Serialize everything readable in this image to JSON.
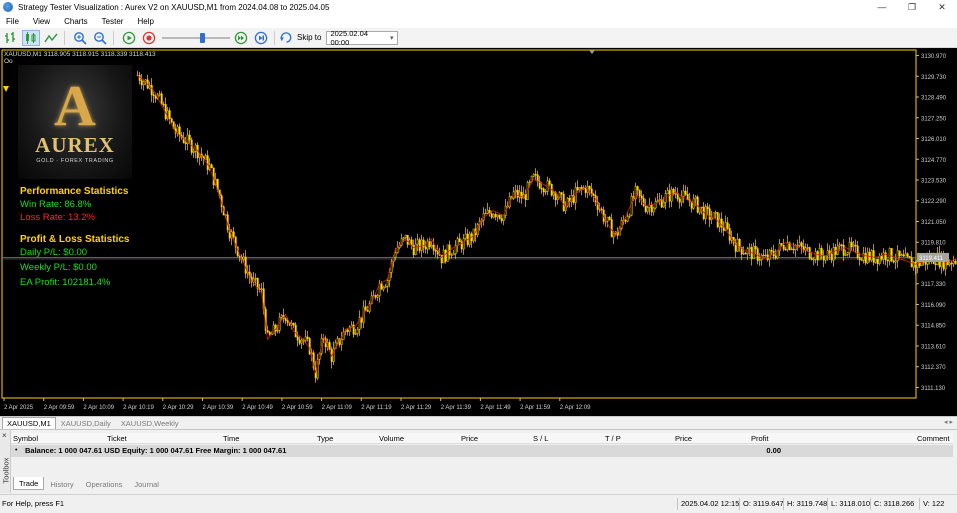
{
  "window": {
    "title": "Strategy Tester Visualization : Aurex V2 on XAUUSD,M1 from 2024.04.08 to 2025.04.05",
    "controls": [
      "—",
      "❐",
      "✕"
    ]
  },
  "menu": [
    "File",
    "View",
    "Charts",
    "Tester",
    "Help"
  ],
  "toolbar": {
    "icons": [
      "bar-chart-icon",
      "candlestick-icon",
      "line-chart-icon",
      "zoom-in-icon",
      "zoom-out-icon",
      "play-icon",
      "stop-icon",
      "fast-forward-icon",
      "step-icon"
    ],
    "speed_level": 0.6,
    "skip_label": "Skip to",
    "skip_date": "2025.02.04 00:00",
    "accent": "#2f6fcf"
  },
  "chart": {
    "header": "XAUUSD,M1  3118.905 3118.915 3118.339 3118.413",
    "sub_header": "Oo",
    "colors": {
      "up": "#ffd400",
      "down": "#ffd400",
      "ma": "#d21f1f",
      "bg": "#000000",
      "grid": "#ffd400"
    },
    "current_price": "3119.411",
    "logo": {
      "letter": "A",
      "word": "AUREX",
      "subtitle": "GOLD · FOREX TRADING"
    },
    "stats": {
      "perf_title": "Performance Statistics",
      "win_rate": "Win Rate: 86.8%",
      "loss_rate": "Loss Rate: 13.2%",
      "pl_title": "Profit & Loss Statistics",
      "daily": "Daily P/L: $0.00",
      "weekly": "Weekly P/L: $0.00",
      "ea_profit": "EA Profit: 102181.4%"
    }
  },
  "chart_data": {
    "type": "candlestick",
    "title": "XAUUSD,M1",
    "y_ticks": [
      "3130.970",
      "3129.730",
      "3128.490",
      "3127.250",
      "3126.010",
      "3124.770",
      "3123.530",
      "3122.290",
      "3121.050",
      "3119.810",
      "3117.330",
      "3116.090",
      "3114.850",
      "3113.610",
      "3112.370",
      "3111.130"
    ],
    "ylim": [
      3110.5,
      3131.3
    ],
    "x_ticks": [
      "2 Apr 2025",
      "2 Apr 09:59",
      "2 Apr 10:09",
      "2 Apr 10:19",
      "2 Apr 10:29",
      "2 Apr 10:39",
      "2 Apr 10:49",
      "2 Apr 10:59",
      "2 Apr 11:09",
      "2 Apr 11:19",
      "2 Apr 11:29",
      "2 Apr 11:39",
      "2 Apr 11:49",
      "2 Apr 11:59",
      "2 Apr 12:09"
    ],
    "price_line": 3118.9,
    "path": [
      [
        0,
        3129.8
      ],
      [
        3,
        3129.5
      ],
      [
        8,
        3128.9
      ],
      [
        13,
        3127.8
      ],
      [
        19,
        3126.4
      ],
      [
        24,
        3125.9
      ],
      [
        30,
        3125.3
      ],
      [
        36,
        3124.3
      ],
      [
        41,
        3122.6
      ],
      [
        46,
        3120.5
      ],
      [
        51,
        3119.1
      ],
      [
        57,
        3117.5
      ],
      [
        62,
        3116.8
      ],
      [
        65,
        3114.0
      ],
      [
        69,
        3114.6
      ],
      [
        74,
        3115.5
      ],
      [
        78,
        3114.5
      ],
      [
        82,
        3114.1
      ],
      [
        86,
        3113.5
      ],
      [
        89,
        3112.0
      ],
      [
        93,
        3114.2
      ],
      [
        97,
        3113.0
      ],
      [
        100,
        3113.7
      ],
      [
        104,
        3114.6
      ],
      [
        109,
        3114.8
      ],
      [
        113,
        3115.5
      ],
      [
        117,
        3116.2
      ],
      [
        121,
        3117.3
      ],
      [
        125,
        3117.6
      ],
      [
        129,
        3119.4
      ],
      [
        134,
        3120.0
      ],
      [
        138,
        3119.5
      ],
      [
        143,
        3119.6
      ],
      [
        147,
        3120.0
      ],
      [
        152,
        3118.9
      ],
      [
        158,
        3119.5
      ],
      [
        163,
        3119.8
      ],
      [
        168,
        3120.2
      ],
      [
        173,
        3121.3
      ],
      [
        178,
        3121.7
      ],
      [
        183,
        3121.4
      ],
      [
        188,
        3122.7
      ],
      [
        193,
        3122.5
      ],
      [
        198,
        3123.6
      ],
      [
        204,
        3123.2
      ],
      [
        209,
        3122.8
      ],
      [
        214,
        3121.9
      ],
      [
        219,
        3122.7
      ],
      [
        224,
        3123.1
      ],
      [
        229,
        3122.4
      ],
      [
        234,
        3121.1
      ],
      [
        239,
        3120.2
      ],
      [
        244,
        3121.3
      ],
      [
        249,
        3122.7
      ],
      [
        254,
        3122.0
      ],
      [
        259,
        3122.1
      ],
      [
        264,
        3122.5
      ],
      [
        269,
        3122.8
      ],
      [
        274,
        3122.4
      ],
      [
        279,
        3122.1
      ],
      [
        284,
        3121.5
      ],
      [
        289,
        3121.2
      ],
      [
        294,
        3120.6
      ],
      [
        299,
        3119.7
      ],
      [
        304,
        3119.3
      ],
      [
        309,
        3119.1
      ],
      [
        314,
        3118.8
      ],
      [
        319,
        3119.2
      ],
      [
        324,
        3119.8
      ],
      [
        329,
        3119.6
      ],
      [
        334,
        3119.3
      ],
      [
        339,
        3119.1
      ],
      [
        344,
        3119.0
      ],
      [
        349,
        3119.3
      ],
      [
        354,
        3119.5
      ],
      [
        359,
        3119.2
      ],
      [
        364,
        3119.0
      ],
      [
        369,
        3118.9
      ],
      [
        374,
        3119.1
      ],
      [
        379,
        3118.9
      ],
      [
        384,
        3118.7
      ],
      [
        389,
        3118.5
      ],
      [
        394,
        3118.7
      ],
      [
        399,
        3118.9
      ],
      [
        404,
        3118.6
      ],
      [
        409,
        3118.8
      ],
      [
        414,
        3118.9
      ],
      [
        419,
        3119.1
      ],
      [
        424,
        3118.9
      ],
      [
        429,
        3118.7
      ],
      [
        434,
        3118.8
      ],
      [
        439,
        3118.9
      ],
      [
        444,
        3118.7
      ],
      [
        449,
        3118.5
      ],
      [
        454,
        3118.8
      ],
      [
        458,
        3118.9
      ]
    ]
  },
  "chart_tabs": [
    "XAUUSD,M1",
    "XAUUSD,Daily",
    "XAUUSD,Weekly"
  ],
  "chart_tab_nav": "◂ ▸",
  "terminal": {
    "toolbox_label": "Toolbox",
    "columns": [
      "Symbol",
      "Ticket",
      "Time",
      "Type",
      "Volume",
      "Price",
      "S / L",
      "T / P",
      "Price",
      "Profit",
      "Comment"
    ],
    "balance_text": "Balance: 1 000 047.61 USD  Equity: 1 000 047.61  Free Margin: 1 000 047.61",
    "balance_profit": "0.00",
    "tabs": [
      "Trade",
      "History",
      "Operations",
      "Journal"
    ]
  },
  "status": {
    "help": "For Help, press F1",
    "datetime": "2025.04.02 12:15",
    "open": "O: 3119.647",
    "high": "H: 3119.748",
    "low": "L: 3118.010",
    "close": "C: 3118.266",
    "volume": "V: 122"
  }
}
